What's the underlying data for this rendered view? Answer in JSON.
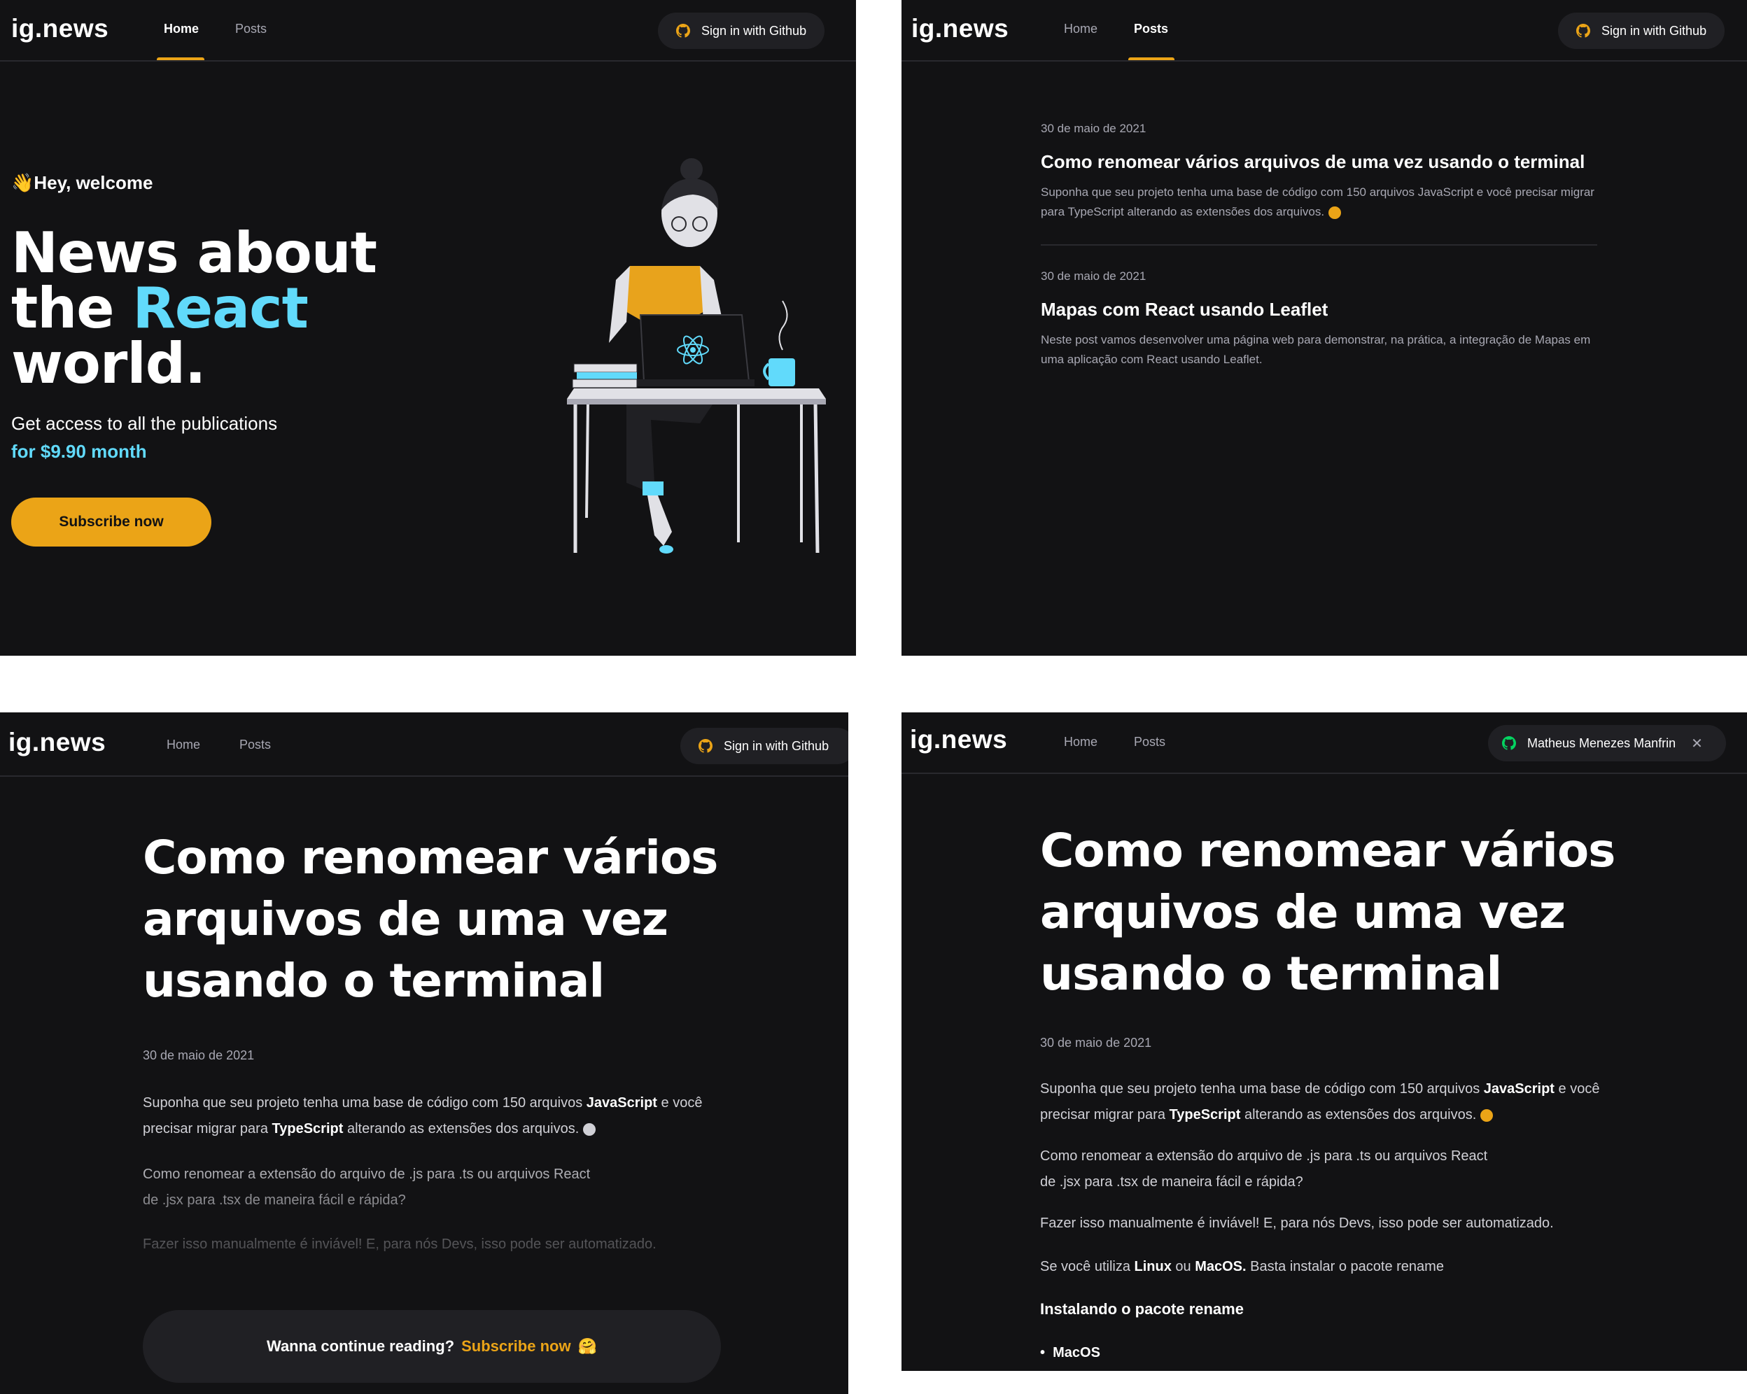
{
  "header": {
    "logo": "ig.news",
    "nav_home": "Home",
    "nav_posts": "Posts",
    "signin_label": "Sign in with Github",
    "user_name": "Matheus Menezes Manfrin",
    "close_glyph": "✕"
  },
  "home": {
    "welcome": "👋Hey, welcome",
    "title_line1": "News about",
    "title_the": "the ",
    "title_react": "React",
    "title_world": "world.",
    "subtitle": "Get access to all the publications",
    "price": "for $9.90 month",
    "subscribe_button": "Subscribe now"
  },
  "posts": [
    {
      "date": "30 de maio de 2021",
      "title": "Como renomear vários arquivos de uma vez usando o terminal",
      "excerpt": "Suponha que seu projeto tenha uma base de código com 150 arquivos JavaScript e você precisar migrar para TypeScript alterando as extensões dos arquivos."
    },
    {
      "date": "30 de maio de 2021",
      "title": "Mapas com React usando Leaflet",
      "excerpt": "Neste post vamos desenvolver uma página web para demonstrar, na prática, a integração de Mapas em uma aplicação com React usando Leaflet."
    }
  ],
  "article": {
    "title_line1": "Como renomear vários",
    "title_line2": "arquivos de uma vez",
    "title_line3": "usando o terminal",
    "date": "30 de maio de 2021",
    "p1_a": "Suponha que seu projeto tenha uma base de código com 150 arquivos ",
    "p1_js": "JavaScript",
    "p1_b": " e você",
    "p1_c": "precisar migrar para ",
    "p1_ts": "TypeScript",
    "p1_d": " alterando as extensões dos arquivos.",
    "p2_line1": "Como renomear a extensão do arquivo de .js para .ts ou arquivos React",
    "p2_line2": "de .jsx para .tsx de maneira fácil e rápida?",
    "p3": "Fazer isso manualmente é inviável! E, para nós Devs, isso pode ser automatizado.",
    "p4_a": "Se você utiliza ",
    "p4_linux": "Linux",
    "p4_b": " ou ",
    "p4_mac": "MacOS.",
    "p4_c": " Basta instalar o pacote rename",
    "h3": "Instalando o pacote rename",
    "li1": "MacOS",
    "continue_text": "Wanna continue reading?",
    "continue_cta": "Subscribe now",
    "continue_emoji": "🤗"
  },
  "colors": {
    "background": "#121214",
    "accent_yellow": "#eba417",
    "react_blue": "#61dafb",
    "github_green": "#04d361"
  }
}
